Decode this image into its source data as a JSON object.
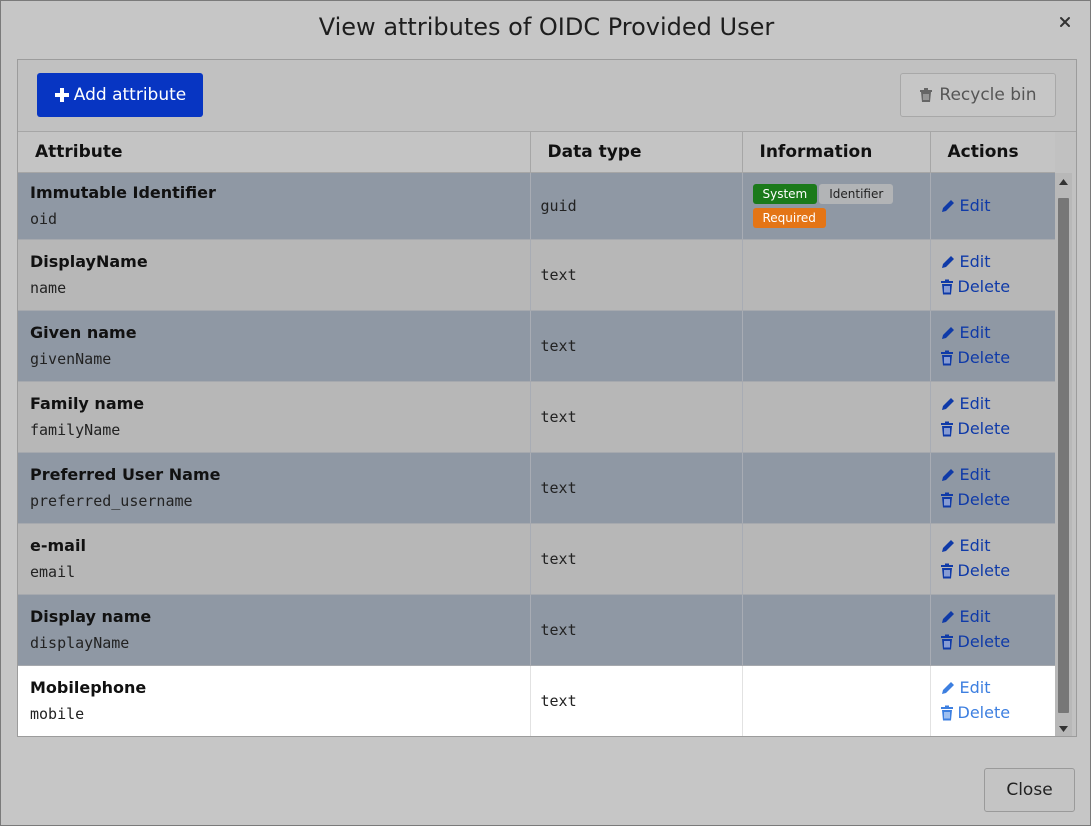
{
  "dialog": {
    "title": "View attributes of OIDC Provided User",
    "close_label": "Close"
  },
  "toolbar": {
    "add_label": "Add attribute",
    "recycle_label": "Recycle bin"
  },
  "columns": [
    "Attribute",
    "Data type",
    "Information",
    "Actions"
  ],
  "rows": [
    {
      "title": "Immutable Identifier",
      "key": "oid",
      "type": "guid",
      "badges": [
        "System",
        "Identifier",
        "Required"
      ],
      "actions": [
        "Edit"
      ]
    },
    {
      "title": "DisplayName",
      "key": "name",
      "type": "text",
      "badges": [],
      "actions": [
        "Edit",
        "Delete"
      ]
    },
    {
      "title": "Given name",
      "key": "givenName",
      "type": "text",
      "badges": [],
      "actions": [
        "Edit",
        "Delete"
      ]
    },
    {
      "title": "Family name",
      "key": "familyName",
      "type": "text",
      "badges": [],
      "actions": [
        "Edit",
        "Delete"
      ]
    },
    {
      "title": "Preferred User Name",
      "key": "preferred_username",
      "type": "text",
      "badges": [],
      "actions": [
        "Edit",
        "Delete"
      ]
    },
    {
      "title": "e-mail",
      "key": "email",
      "type": "text",
      "badges": [],
      "actions": [
        "Edit",
        "Delete"
      ]
    },
    {
      "title": "Display name",
      "key": "displayName",
      "type": "text",
      "badges": [],
      "actions": [
        "Edit",
        "Delete"
      ]
    },
    {
      "title": "Mobilephone",
      "key": "mobile",
      "type": "text",
      "badges": [],
      "actions": [
        "Edit",
        "Delete"
      ]
    }
  ],
  "colors": {
    "primary": "#0735c2",
    "badge_system": "#1b7a1b",
    "badge_required": "#e47516",
    "link": "#0f3aa8"
  },
  "icons": {
    "add": "plus-icon",
    "recycle": "trash-icon",
    "edit": "pencil-icon",
    "delete": "trash-icon",
    "close": "close-icon"
  }
}
